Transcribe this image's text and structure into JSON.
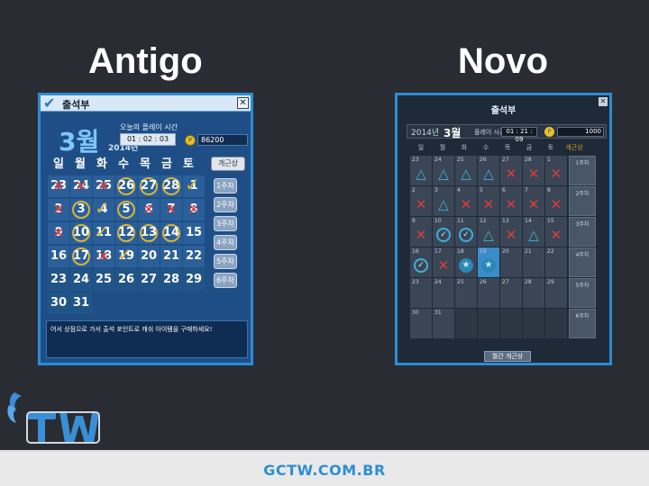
{
  "headings": {
    "left": "Antigo",
    "right": "Novo"
  },
  "old_panel": {
    "title": "출석부",
    "close_glyph": "✕",
    "month": "3월",
    "year": "2014년",
    "play_label": "오늘의 플레이 시간",
    "play_time": "01 : 02 : 03",
    "points": "86200",
    "weekly_button": "개근상",
    "weekday_headers": [
      "일",
      "월",
      "화",
      "수",
      "목",
      "금",
      "토"
    ],
    "weeks": [
      [
        "23",
        "24",
        "25",
        "26",
        "27",
        "28",
        "1"
      ],
      [
        "2",
        "3",
        "4",
        "5",
        "6",
        "7",
        "8"
      ],
      [
        "9",
        "10",
        "11",
        "12",
        "13",
        "14",
        "15"
      ],
      [
        "16",
        "17",
        "18",
        "19",
        "20",
        "21",
        "22"
      ],
      [
        "23",
        "24",
        "25",
        "26",
        "27",
        "28",
        "29"
      ],
      [
        "30",
        "31",
        "",
        "",
        "",
        "",
        ""
      ]
    ],
    "week_buttons": [
      "1주차",
      "2주차",
      "3주차",
      "4주차",
      "5주차",
      "6주차"
    ],
    "message": "어서 상점으로 가서 출석 포인트로 캐쉬 아이템을 구매하세요!"
  },
  "new_panel": {
    "title": "출석부",
    "close_glyph": "✕",
    "year": "2014년",
    "month": "3월",
    "play_label": "플레이 시간",
    "play_time": "01 : 21 : 09",
    "points": "1000",
    "weekday_headers": [
      "일",
      "월",
      "화",
      "수",
      "목",
      "금",
      "토",
      "개근상"
    ],
    "weeks": [
      [
        "23",
        "24",
        "25",
        "26",
        "27",
        "28",
        "1"
      ],
      [
        "2",
        "3",
        "4",
        "5",
        "6",
        "7",
        "8"
      ],
      [
        "9",
        "10",
        "11",
        "12",
        "13",
        "14",
        "15"
      ],
      [
        "16",
        "17",
        "18",
        "19",
        "20",
        "21",
        "22"
      ],
      [
        "23",
        "24",
        "25",
        "26",
        "27",
        "28",
        "29"
      ],
      [
        "30",
        "31",
        "",
        "",
        "",
        "",
        ""
      ]
    ],
    "week_labels": [
      "1주차",
      "2주차",
      "3주차",
      "4주차",
      "5주차",
      "6주차"
    ],
    "monthly_button": "월간 개근상"
  },
  "footer": {
    "site": "GCTW.COM.BR"
  },
  "colors": {
    "accent": "#2b8cd4",
    "background": "#2a2c33",
    "footer_text": "#2e8fd0"
  }
}
